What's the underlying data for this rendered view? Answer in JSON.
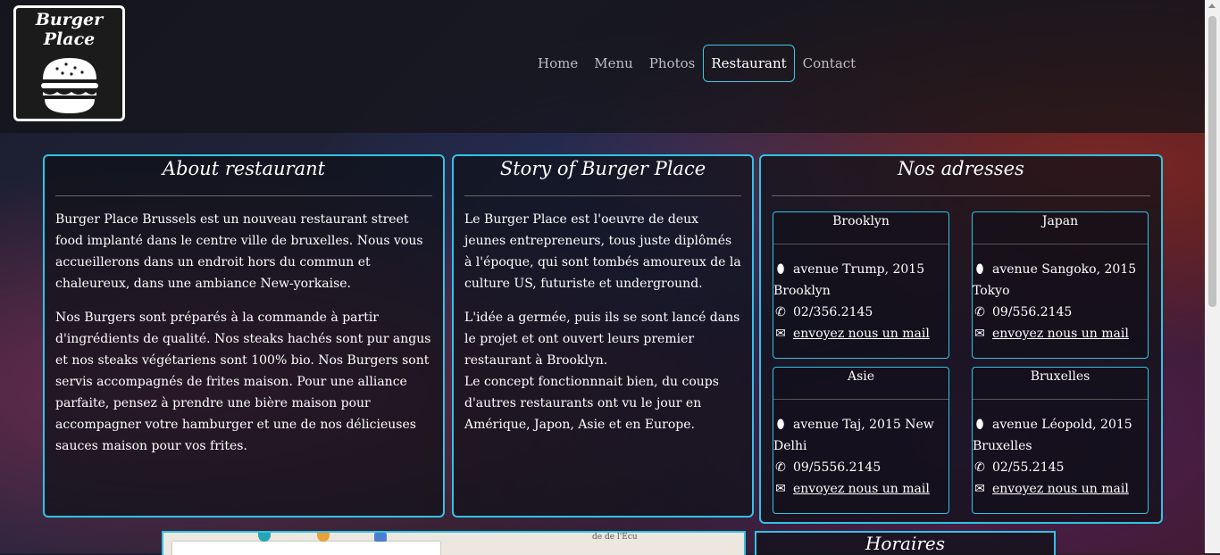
{
  "brand": {
    "name": "Burger Place"
  },
  "nav": [
    {
      "label": "Home"
    },
    {
      "label": "Menu"
    },
    {
      "label": "Photos"
    },
    {
      "label": "Restaurant"
    },
    {
      "label": "Contact"
    }
  ],
  "about": {
    "title": "About restaurant",
    "p1": "Burger Place Brussels est un nouveau restaurant street food implanté dans le centre ville de bruxelles. Nous vous accueillerons dans un endroit hors du commun et chaleureux, dans une ambiance New-yorkaise.",
    "p2": "Nos Burgers sont préparés à la commande à partir d'ingrédients de qualité. Nos steaks hachés sont pur angus et nos steaks végétariens sont 100% bio. Nos Burgers sont servis accompagnés de frites maison. Pour une alliance parfaite, pensez à prendre une bière maison pour accompagner votre hamburger et une de nos délicieuses sauces maison pour vos frites."
  },
  "story": {
    "title": "Story of Burger Place",
    "p1": "Le Burger Place est l'oeuvre de deux jeunes entrepreneurs, tous juste diplômés à l'époque, qui sont tombés amoureux de la culture US, futuriste et underground.",
    "p2a": "L'idée a germée, puis ils se sont lancé dans le projet et ont ouvert leurs premier restaurant à Brooklyn.",
    "p2b": "Le concept fonctionnnait bien, du coups d'autres restaurants ont vu le jour en Amérique, Japon, Asie et en Europe."
  },
  "addresses": {
    "title": "Nos adresses",
    "items": [
      {
        "city": "Brooklyn",
        "address": "avenue Trump, 2015 Brooklyn",
        "phone": "02/356.2145",
        "mail": "envoyez nous un mail"
      },
      {
        "city": "Japan",
        "address": "avenue Sangoko, 2015 Tokyo",
        "phone": "09/556.2145",
        "mail": "envoyez nous un mail"
      },
      {
        "city": "Asie",
        "address": "avenue Taj, 2015 New Delhi",
        "phone": "09/5556.2145",
        "mail": "envoyez nous un mail"
      },
      {
        "city": "Bruxelles",
        "address": "avenue Léopold, 2015 Bruxelles",
        "phone": "02/55.2145",
        "mail": "envoyez nous un mail"
      }
    ]
  },
  "map": {
    "road_label": "de de l'Ecu"
  },
  "hours": {
    "title": "Horaires"
  },
  "icons": {
    "address": "map-marker-icon",
    "phone": "phone-icon",
    "mail": "envelope-icon"
  },
  "colors": {
    "accent": "#2ec4e4",
    "active_nav_border": "#3ec8e6"
  }
}
